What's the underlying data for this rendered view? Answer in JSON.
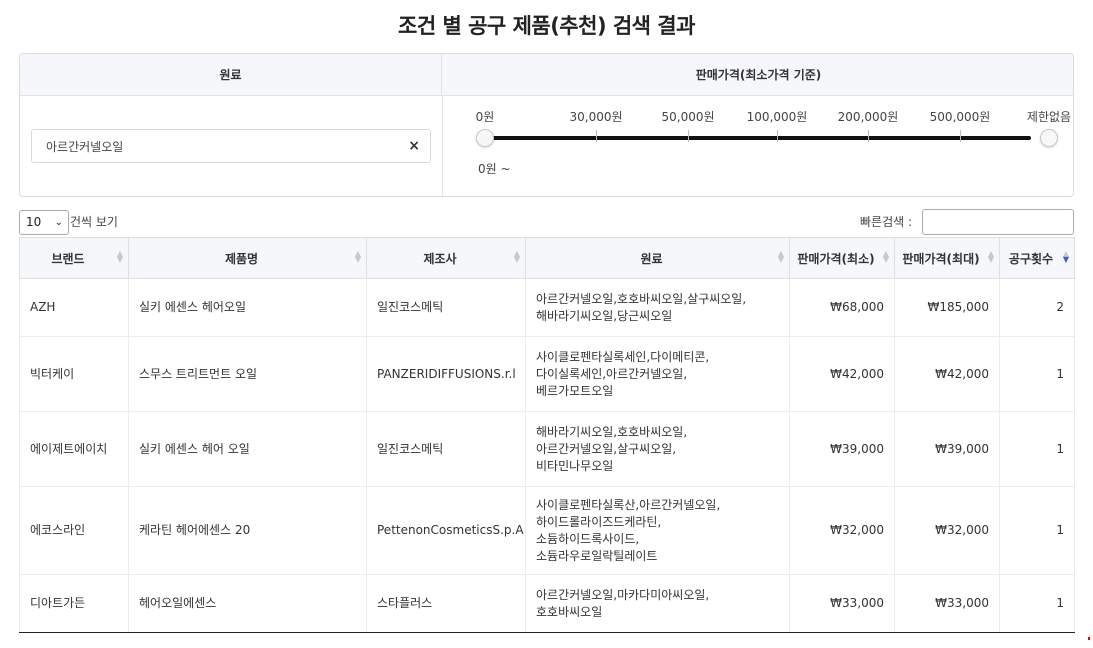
{
  "page": {
    "title": "조건 별 공구 제품(추천) 검색 결과"
  },
  "filters": {
    "ingredient_header": "원료",
    "price_header": "판매가격(최소가격 기준)",
    "ingredient_value": "아르간커넬오일",
    "clear_icon": "×",
    "price_ticks": [
      "0원",
      "30,000원",
      "50,000원",
      "100,000원",
      "200,000원",
      "500,000원",
      "제한없음"
    ],
    "price_readout": "0원 ~",
    "range": {
      "min_index": 0,
      "max_index": 6
    }
  },
  "controls": {
    "page_length_value": "10",
    "page_length_chevron": "⌄",
    "page_length_label": "건씩 보기",
    "search_label": "빠른검색 :"
  },
  "table": {
    "columns": [
      "브랜드",
      "제품명",
      "제조사",
      "원료",
      "판매가격(최소)",
      "판매가격(최대)",
      "공구횟수"
    ],
    "sort_icons": {
      "up": "▲",
      "down": "▼"
    },
    "rows": [
      {
        "brand": "AZH",
        "product": "실키 에센스 헤어오일",
        "maker": "일진코스메틱",
        "ingredients": [
          "아르간커넬오일,호호바씨오일,살구씨오일,",
          "해바라기씨오일,당근씨오일"
        ],
        "price_min": "₩68,000",
        "price_max": "₩185,000",
        "count": "2"
      },
      {
        "brand": "빅터케이",
        "product": "스무스 트리트먼트 오일",
        "maker": "PANZERIDIFFUSIONS.r.l",
        "ingredients": [
          "사이클로펜타실록세인,다이메티콘,",
          "다이실록세인,아르간커넬오일,",
          "베르가모트오일"
        ],
        "price_min": "₩42,000",
        "price_max": "₩42,000",
        "count": "1"
      },
      {
        "brand": "에이제트에이치",
        "product": "실키 에센스 헤어 오일",
        "maker": "일진코스메틱",
        "ingredients": [
          "해바라기씨오일,호호바씨오일,",
          "아르간커넬오일,살구씨오일,",
          "비타민나무오일"
        ],
        "price_min": "₩39,000",
        "price_max": "₩39,000",
        "count": "1"
      },
      {
        "brand": "에코스라인",
        "product": "케라틴 헤어에센스 20",
        "maker": "PettenonCosmeticsS.p.A",
        "ingredients": [
          "사이클로펜타실록산,아르간커넬오일,",
          "하이드롤라이즈드케라틴,",
          "소듐하이드록사이드,",
          "소듐라우로일락틸레이트"
        ],
        "price_min": "₩32,000",
        "price_max": "₩32,000",
        "count": "1"
      },
      {
        "brand": "디아트가든",
        "product": "헤어오일에센스",
        "maker": "스타플러스",
        "ingredients": [
          "아르간커넬오일,마카다미아씨오일,",
          "호호바씨오일"
        ],
        "price_min": "₩33,000",
        "price_max": "₩33,000",
        "count": "1"
      }
    ]
  },
  "colors": {
    "accent": "#3a5fcd",
    "header_bg": "#f5f7fa",
    "slider": "#111111"
  }
}
